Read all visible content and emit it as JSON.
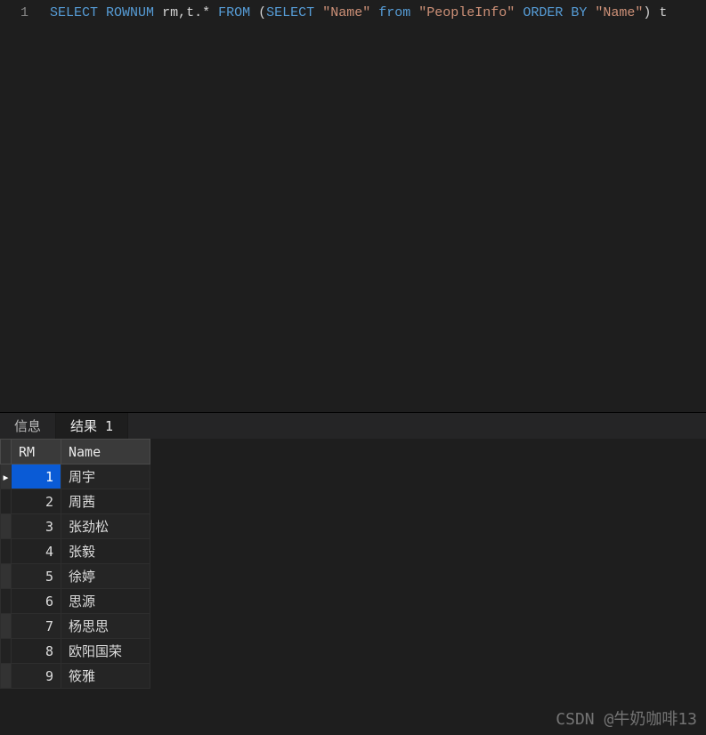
{
  "editor": {
    "line_number": "1",
    "sql": {
      "select": "SELECT",
      "rownum": "ROWNUM",
      "alias_rm": "rm",
      "comma": ",",
      "t_star": "t.*",
      "from1": "FROM",
      "lp": "(",
      "select2": "SELECT",
      "name_col": "\"Name\"",
      "from2": "from",
      "table": "\"PeopleInfo\"",
      "order": "ORDER",
      "by": "BY",
      "name_col2": "\"Name\"",
      "rp": ")",
      "alias_t": "t"
    }
  },
  "tabs": {
    "info": "信息",
    "result1": "结果 1"
  },
  "columns": {
    "rm": "RM",
    "name": "Name"
  },
  "rows": [
    {
      "rm": "1",
      "name": "周宇",
      "selected": true,
      "marker": "▸"
    },
    {
      "rm": "2",
      "name": "周茜"
    },
    {
      "rm": "3",
      "name": "张劲松"
    },
    {
      "rm": "4",
      "name": "张毅"
    },
    {
      "rm": "5",
      "name": "徐婷"
    },
    {
      "rm": "6",
      "name": "思源"
    },
    {
      "rm": "7",
      "name": "杨思思"
    },
    {
      "rm": "8",
      "name": "欧阳国荣"
    },
    {
      "rm": "9",
      "name": "筱雅"
    }
  ],
  "watermark": "CSDN @牛奶咖啡13"
}
